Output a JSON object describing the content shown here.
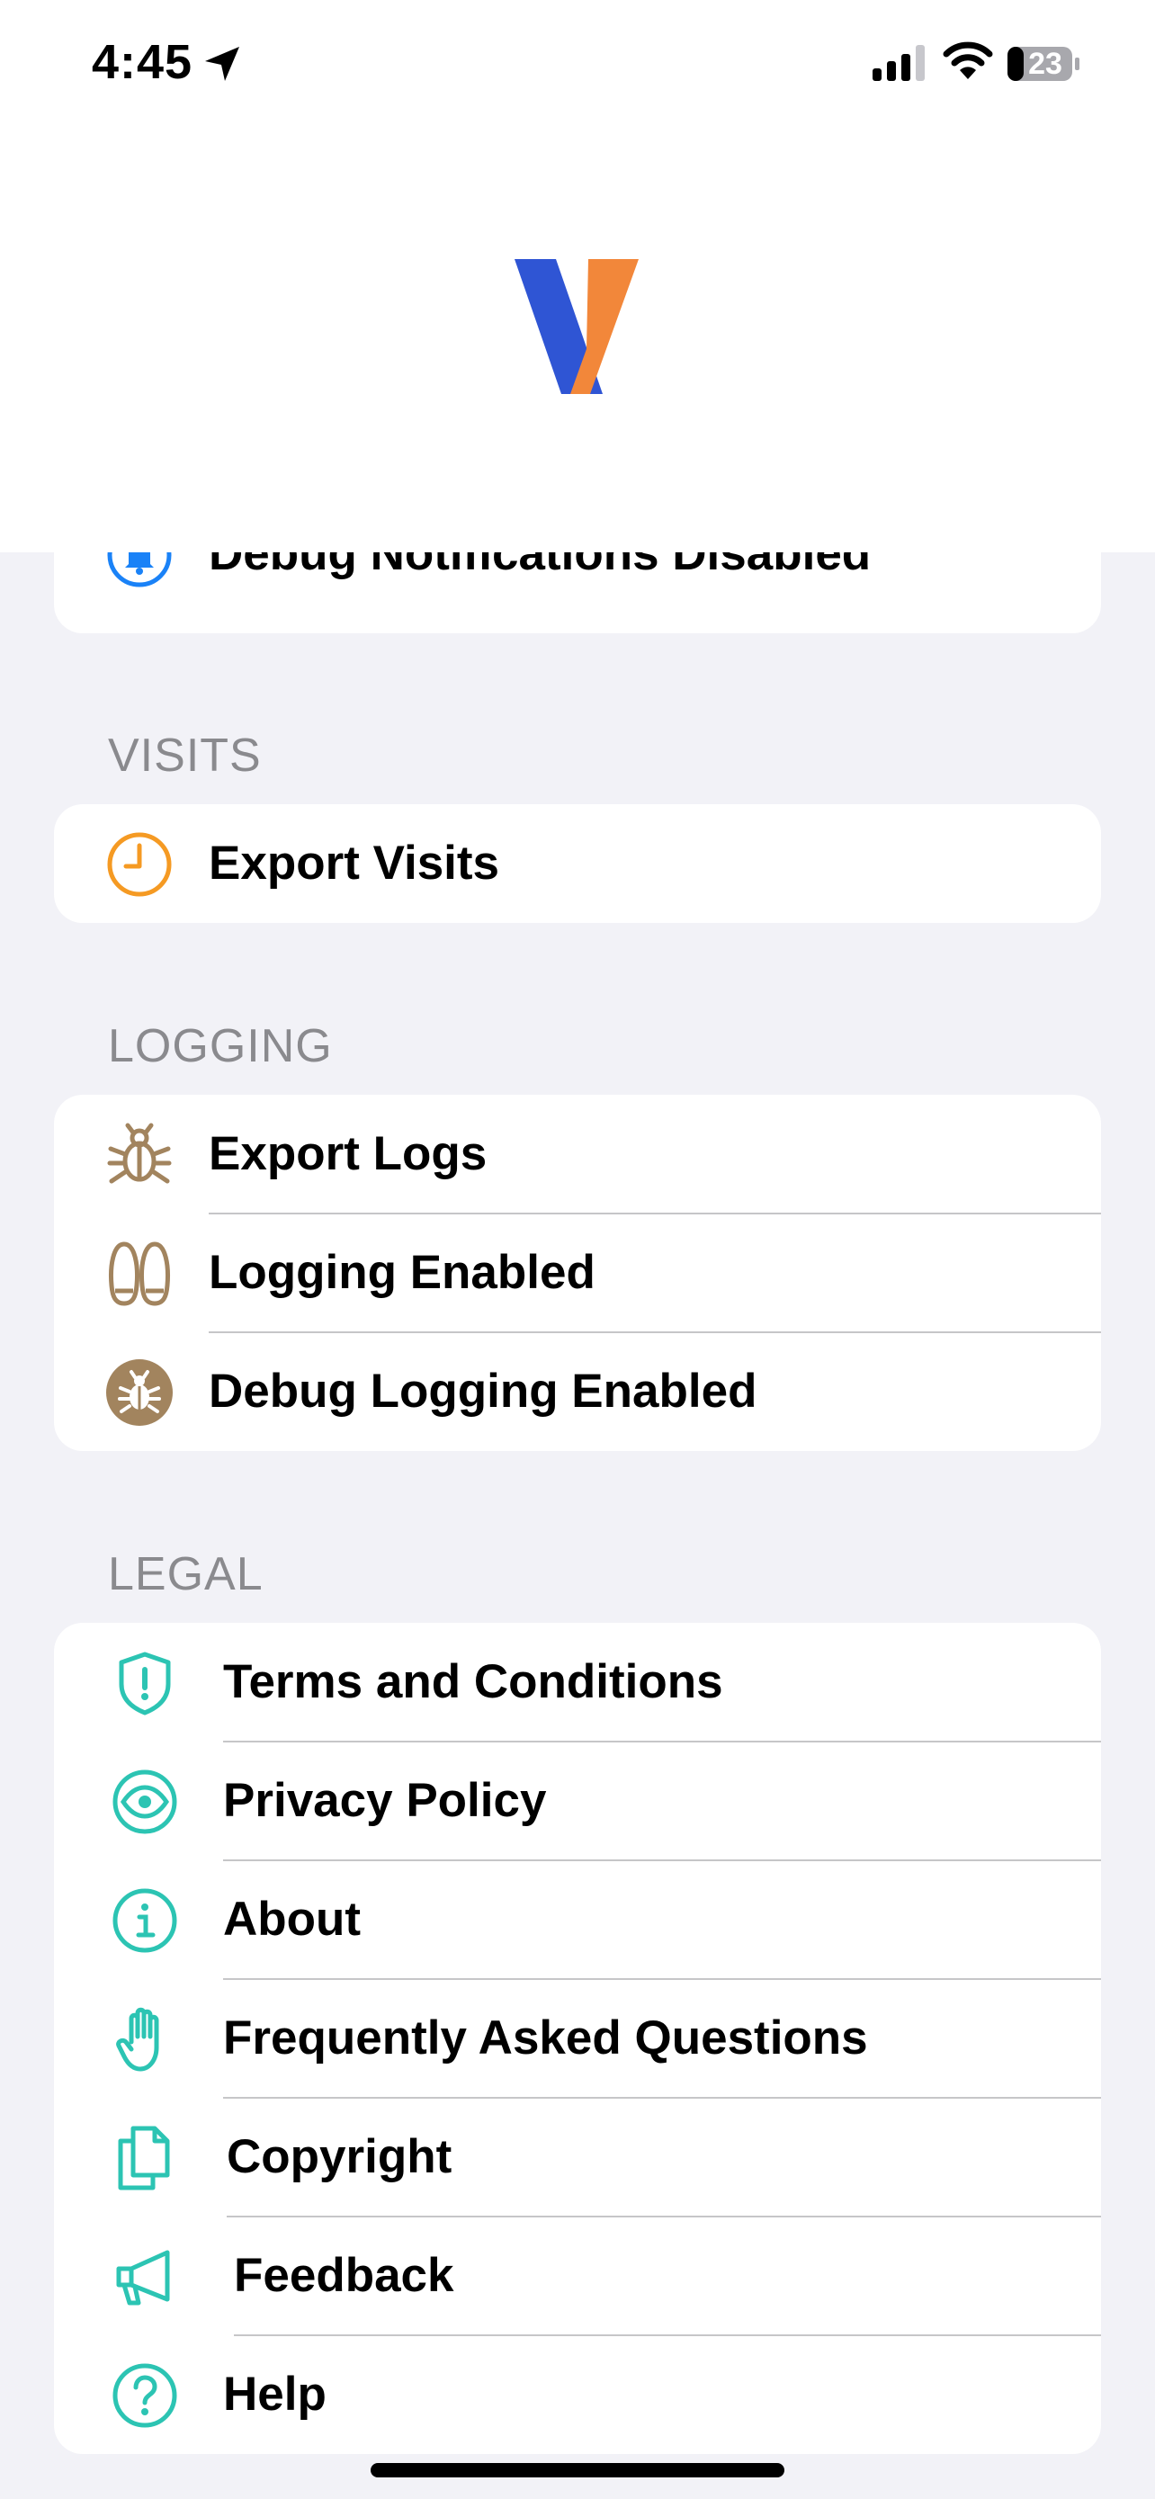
{
  "status_bar": {
    "time": "4:45",
    "battery_level": "23"
  },
  "notifications": {
    "debug_notifications_label": "Debug Notifications Disabled"
  },
  "sections": {
    "visits": {
      "header": "VISITS",
      "items": [
        {
          "label": "Export Visits",
          "icon": "clock-icon"
        }
      ]
    },
    "logging": {
      "header": "LOGGING",
      "items": [
        {
          "label": "Export Logs",
          "icon": "bug-icon"
        },
        {
          "label": "Logging Enabled",
          "icon": "footprints-icon"
        },
        {
          "label": "Debug Logging Enabled",
          "icon": "bug-circle-icon"
        }
      ]
    },
    "legal": {
      "header": "LEGAL",
      "items": [
        {
          "label": "Terms and Conditions",
          "icon": "shield-exclamation-icon"
        },
        {
          "label": "Privacy Policy",
          "icon": "eye-icon"
        },
        {
          "label": "About",
          "icon": "info-icon"
        },
        {
          "label": "Frequently Asked Questions",
          "icon": "hand-icon"
        },
        {
          "label": "Copyright",
          "icon": "documents-icon"
        },
        {
          "label": "Feedback",
          "icon": "megaphone-icon"
        },
        {
          "label": "Help",
          "icon": "question-icon"
        }
      ]
    }
  },
  "colors": {
    "background": "#f2f2f7",
    "card": "#ffffff",
    "section_header": "#8a8a8e",
    "blue_icon": "#1a82f7",
    "orange_icon": "#f59a23",
    "brown_icon": "#a2845e",
    "teal_icon": "#2cc4b3",
    "logo_blue": "#2f55d4",
    "logo_orange": "#f2873a"
  }
}
